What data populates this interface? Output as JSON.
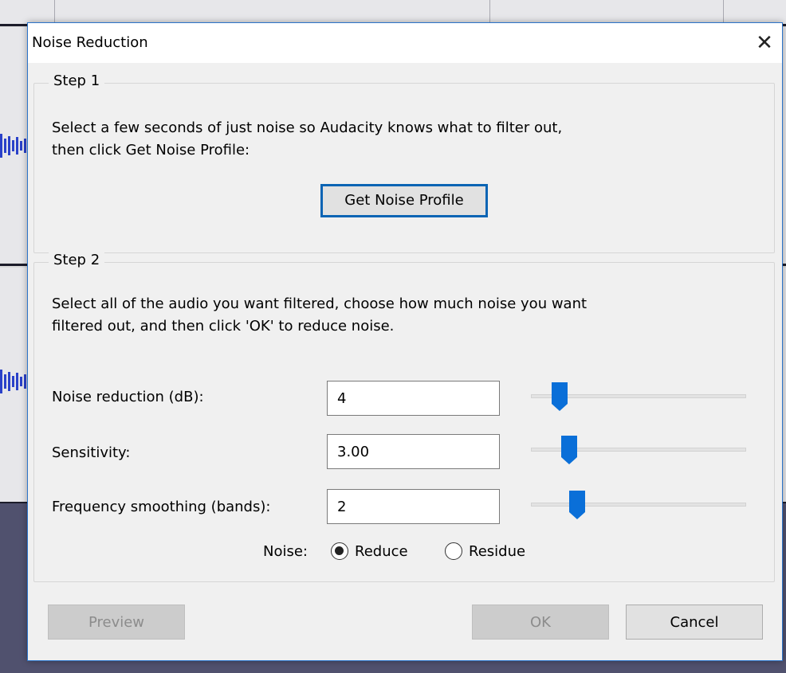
{
  "dialog": {
    "title": "Noise Reduction",
    "close_icon": "close-icon"
  },
  "step1": {
    "title": "Step 1",
    "desc_line1": "Select a few seconds of just noise so Audacity knows what to filter out,",
    "desc_line2": "then click Get Noise Profile:",
    "button_label": "Get Noise Profile"
  },
  "step2": {
    "title": "Step 2",
    "desc_line1": "Select all of the audio you want filtered, choose how much noise you want",
    "desc_line2": "filtered out, and then click 'OK' to reduce noise.",
    "rows": [
      {
        "label": "Noise reduction (dB):",
        "value": "4",
        "slider_fraction": 0.1
      },
      {
        "label": "Sensitivity:",
        "value": "3.00",
        "slider_fraction": 0.15
      },
      {
        "label": "Frequency smoothing (bands):",
        "value": "2",
        "slider_fraction": 0.19
      }
    ],
    "noise": {
      "label": "Noise:",
      "options": [
        {
          "label": "Reduce",
          "checked": true
        },
        {
          "label": "Residue",
          "checked": false
        }
      ]
    }
  },
  "buttons": {
    "preview": "Preview",
    "ok": "OK",
    "cancel": "Cancel"
  },
  "colors": {
    "accent": "#0a64b4",
    "slider_thumb": "#0a6fd8",
    "waveform": "#2a41c9"
  }
}
